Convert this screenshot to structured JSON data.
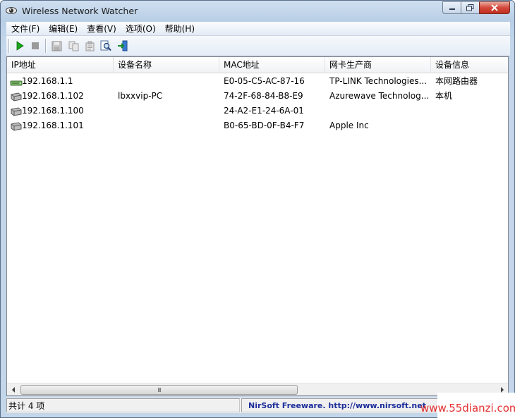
{
  "window": {
    "title": "Wireless Network Watcher"
  },
  "menu": {
    "items": [
      "文件(F)",
      "编辑(E)",
      "查看(V)",
      "选项(O)",
      "帮助(H)"
    ]
  },
  "table": {
    "columns": [
      "IP地址",
      "设备名称",
      "MAC地址",
      "网卡生产商",
      "设备信息"
    ],
    "rows": [
      {
        "ip": "192.168.1.1",
        "name": "",
        "mac": "E0-05-C5-AC-87-16",
        "vendor": "TP-LINK Technologies...",
        "info": "本网路由器",
        "icon": "router-icon"
      },
      {
        "ip": "192.168.1.102",
        "name": "lbxxvip-PC",
        "mac": "74-2F-68-84-B8-E9",
        "vendor": "Azurewave Technolog...",
        "info": "本机",
        "icon": "network-device-icon"
      },
      {
        "ip": "192.168.1.100",
        "name": "",
        "mac": "24-A2-E1-24-6A-01",
        "vendor": "",
        "info": "",
        "icon": "network-device-icon"
      },
      {
        "ip": "192.168.1.101",
        "name": "",
        "mac": "B0-65-BD-0F-B4-F7",
        "vendor": "Apple Inc",
        "info": "",
        "icon": "network-device-icon"
      }
    ]
  },
  "scrollbar": {
    "thumb_grip": "III"
  },
  "status": {
    "count": "共计 4 项",
    "credit": "NirSoft Freeware.  http://www.nirsoft.net"
  },
  "watermark": {
    "text": "www.55dianzi.com"
  },
  "colors": {
    "play": "#1aa51a",
    "credit": "#1c2d9a",
    "watermark": "#e52f2f"
  }
}
